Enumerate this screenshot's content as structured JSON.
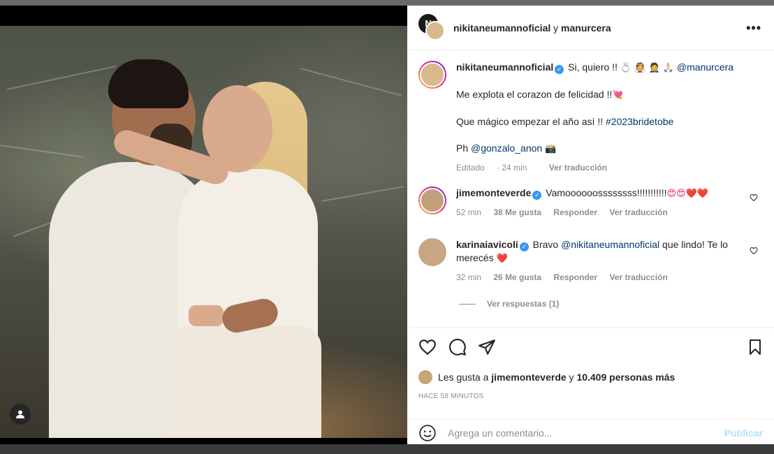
{
  "post": {
    "header": {
      "author1": "nikitaneumannoficial",
      "connector": "y",
      "author2": "manurcera",
      "more_icon": "more-options-icon"
    },
    "caption": {
      "username": "nikitaneumannoficial",
      "line1_text": "Si, quiero !!",
      "line1_emojis": "💍 👰 🤵 🙏🏻",
      "line1_mention": "@manurcera",
      "line2": "Me explota el corazon de felicidad !!",
      "line2_emoji": "💘",
      "line3_text": "Que mágico empezar el año así !!",
      "line3_hashtag": "#2023bridetobe",
      "line4_prefix": "Ph",
      "line4_mention": "@gonzalo_anon",
      "line4_emoji": "📸",
      "meta_edited": "Editado",
      "meta_time": "24 min",
      "meta_translate": "Ver traducción"
    },
    "comments": [
      {
        "username": "jimemonteverde",
        "text": "Vamoooooossssssss!!!!!!!!!!!",
        "emojis": "😍😍❤️❤️",
        "time": "52 min",
        "likes": "38 Me gusta",
        "reply": "Responder",
        "translate": "Ver traducción"
      },
      {
        "username": "karinaiavicoli",
        "text_prefix": "Bravo",
        "mention": "@nikitaneumannoficial",
        "text_suffix": "que lindo! Te lo merecés",
        "emoji": "❤️",
        "time": "32 min",
        "likes": "26 Me gusta",
        "reply": "Responder",
        "translate": "Ver traducción",
        "view_replies": "Ver respuestas (1)"
      }
    ],
    "likes": {
      "prefix": "Les gusta a",
      "user": "jimemonteverde",
      "connector": "y",
      "count": "10.409 personas más"
    },
    "timestamp": "HACE 58 MINUTOS",
    "comment_input": {
      "placeholder": "Agrega un comentario...",
      "publish_label": "Publicar"
    }
  }
}
